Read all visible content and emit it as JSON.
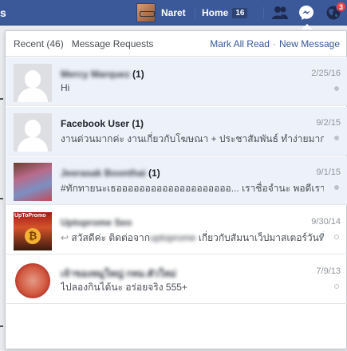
{
  "topbar": {
    "left_glyph": "s",
    "profile_name": "Naret",
    "home_label": "Home",
    "home_count": "16",
    "notification_badge": "3",
    "colors": {
      "bar": "#3b5998",
      "badge": "#fa3e3e"
    }
  },
  "flyout": {
    "tab_recent": "Recent (46)",
    "tab_requests": "Message Requests",
    "mark_all_read": "Mark All Read",
    "separator": "·",
    "new_message": "New Message"
  },
  "threads": [
    {
      "name": "Mercy Marquez",
      "count": " (1)",
      "snippet": "Hi",
      "date": "2/25/16",
      "unread": true,
      "avatar": "default-avatar"
    },
    {
      "name": "Facebook User",
      "count": " (1)",
      "snippet": "งานด่วนมากค่ะ งานเกี่ยวกับโฆษณา + ประชาสัมพันธ์ ทำง่ายมาก...",
      "date": "9/2/15",
      "unread": true,
      "avatar": "default-avatar"
    },
    {
      "name": "Jeerasak Boonthai",
      "count": " (1)",
      "snippet": "#ทักทายนะเธออออออออออออออออออออ... เราชื่อจำนะ พอดีเรามีง...",
      "date": "9/1/15",
      "unread": true,
      "avatar": "photo"
    },
    {
      "name": "Uptoprome Seo",
      "count": "",
      "snippet": "สวัสดีค่ะ ติดต่อจาก",
      "snippet_blur": "uptoprome",
      "snippet_tail": " เกี่ยวกับสัมนาเว็ปมาสเตอร์วันที่...",
      "date": "9/30/14",
      "unread": false,
      "avatar": "UpToPromo"
    },
    {
      "name": "เจ้าของหมูใหญ่ กทม.ตัวใหม่",
      "count": "",
      "snippet": "ไปลองกินได้นะ อร่อยจริง 555+",
      "date": "7/9/13",
      "unread": false,
      "avatar": "photo"
    }
  ]
}
